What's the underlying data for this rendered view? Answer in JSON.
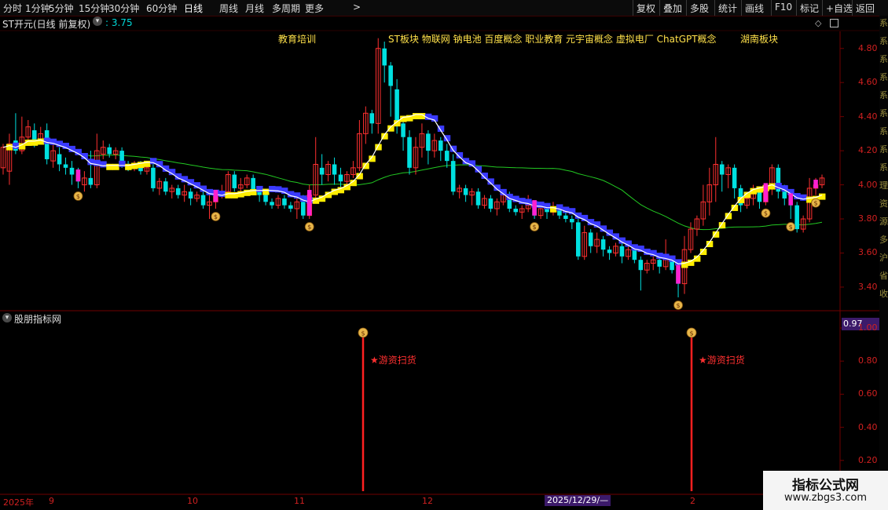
{
  "toolbar": {
    "left_items": [
      "分时",
      "1分钟",
      "5分钟",
      "15分钟",
      "30分钟",
      "60分钟",
      "日线",
      "周线",
      "月线",
      "多周期",
      "更多"
    ],
    "active": "日线",
    "more_arrow": ">",
    "right_items": [
      "复权",
      "叠加",
      "多股",
      "统计",
      "画线",
      "F10",
      "标记",
      "+自选",
      "返回"
    ]
  },
  "main_title": {
    "name": "ST开元(日线 前复权)",
    "price_label": ": 3.75",
    "price_color": "#00d8d8"
  },
  "concepts": [
    {
      "text": "教育培训"
    },
    {
      "text": "ST板块 物联网 钠电池 百度概念 职业教育 元宇宙概念 虚拟电厂 ChatGPT概念"
    },
    {
      "text": "湖南板块"
    }
  ],
  "right_strip_chars": [
    "系",
    "系",
    "系",
    "系",
    "系",
    "系",
    "系",
    "系",
    "系",
    "理",
    "资",
    "源",
    "多",
    "沪",
    "省",
    "收"
  ],
  "price_axis": [
    "4.80",
    "4.60",
    "4.40",
    "4.20",
    "4.00",
    "3.80",
    "3.60",
    "3.40"
  ],
  "indicator": {
    "name": "股朋指标网",
    "current_value": "0.97",
    "axis": [
      "1.00",
      "0.80",
      "0.60",
      "0.40",
      "0.20"
    ],
    "signal_text": "★游资扫货",
    "bag_glyph": "$"
  },
  "date_axis": {
    "labels": [
      "2025年",
      "9",
      "10",
      "11",
      "12",
      "2"
    ],
    "cursor_date": "2025/12/29/—"
  },
  "watermark": {
    "line1": "指标公式网",
    "line2": "www.zbgs3.com"
  },
  "colors": {
    "up": "#ff3030",
    "down": "#00e0e0",
    "yellow": "#ffee00",
    "blue": "#3a3aff",
    "magenta": "#ff20d0",
    "green_ma": "#22c822",
    "white_ma": "#ffffff",
    "grid": "#700000"
  },
  "chart_data": {
    "type": "candlestick",
    "y_range": [
      3.28,
      4.9
    ],
    "candles": [
      [
        4.1,
        4.22,
        4.06,
        4.24
      ],
      [
        4.08,
        4.24,
        4.0,
        4.3
      ],
      [
        4.26,
        4.2,
        4.18,
        4.42
      ],
      [
        4.2,
        4.28,
        4.18,
        4.4
      ],
      [
        4.28,
        4.34,
        4.24,
        4.38
      ],
      [
        4.32,
        4.26,
        4.22,
        4.36
      ],
      [
        4.26,
        4.3,
        4.24,
        4.34
      ],
      [
        4.32,
        4.15,
        4.12,
        4.36
      ],
      [
        4.14,
        4.2,
        4.1,
        4.25
      ],
      [
        4.18,
        4.12,
        4.08,
        4.22
      ],
      [
        4.12,
        4.1,
        4.06,
        4.16
      ],
      [
        4.1,
        4.06,
        4.0,
        4.14
      ],
      [
        4.06,
        4.02,
        3.98,
        4.1
      ],
      [
        4.0,
        4.04,
        3.96,
        4.08
      ],
      [
        4.04,
        4.0,
        3.98,
        4.2
      ],
      [
        4.0,
        4.2,
        3.98,
        4.3
      ],
      [
        4.18,
        4.22,
        4.15,
        4.26
      ],
      [
        4.22,
        4.18,
        4.16,
        4.24
      ],
      [
        4.18,
        4.2,
        4.15,
        4.22
      ],
      [
        4.2,
        4.12,
        4.1,
        4.22
      ],
      [
        4.12,
        4.1,
        4.08,
        4.14
      ],
      [
        4.1,
        4.12,
        4.08,
        4.14
      ],
      [
        4.12,
        4.08,
        4.06,
        4.14
      ],
      [
        4.08,
        4.1,
        4.06,
        4.12
      ],
      [
        4.1,
        3.98,
        3.96,
        4.12
      ],
      [
        3.98,
        4.02,
        3.94,
        4.04
      ],
      [
        4.02,
        3.96,
        3.94,
        4.04
      ],
      [
        3.96,
        3.98,
        3.92,
        4.0
      ],
      [
        3.98,
        3.94,
        3.92,
        4.0
      ],
      [
        3.94,
        3.96,
        3.9,
        4.0
      ],
      [
        3.96,
        3.92,
        3.88,
        3.98
      ],
      [
        3.92,
        3.94,
        3.9,
        3.96
      ],
      [
        3.94,
        3.88,
        3.86,
        3.96
      ],
      [
        3.88,
        3.9,
        3.8,
        3.94
      ],
      [
        3.9,
        3.94,
        3.86,
        3.96
      ],
      [
        3.94,
        3.96,
        3.92,
        4.0
      ],
      [
        3.96,
        4.06,
        3.94,
        4.08
      ],
      [
        4.06,
        3.98,
        3.96,
        4.08
      ],
      [
        3.98,
        4.0,
        3.94,
        4.04
      ],
      [
        4.0,
        4.04,
        3.98,
        4.06
      ],
      [
        4.04,
        3.96,
        3.94,
        4.06
      ],
      [
        3.96,
        3.94,
        3.9,
        3.98
      ],
      [
        3.94,
        3.9,
        3.88,
        3.96
      ],
      [
        3.9,
        3.88,
        3.86,
        3.92
      ],
      [
        3.88,
        3.92,
        3.86,
        3.94
      ],
      [
        3.92,
        3.88,
        3.86,
        3.94
      ],
      [
        3.88,
        3.86,
        3.84,
        3.9
      ],
      [
        3.86,
        3.9,
        3.8,
        3.92
      ],
      [
        3.9,
        3.82,
        3.8,
        3.94
      ],
      [
        3.82,
        3.94,
        3.8,
        4.0
      ],
      [
        3.94,
        4.12,
        3.92,
        4.28
      ],
      [
        4.1,
        4.06,
        4.0,
        4.18
      ],
      [
        4.06,
        4.12,
        4.02,
        4.14
      ],
      [
        4.12,
        4.06,
        4.0,
        4.16
      ],
      [
        4.06,
        4.02,
        3.98,
        4.1
      ],
      [
        4.02,
        4.06,
        4.0,
        4.08
      ],
      [
        4.06,
        4.1,
        4.04,
        4.14
      ],
      [
        4.1,
        4.3,
        4.08,
        4.38
      ],
      [
        4.3,
        4.42,
        4.24,
        4.46
      ],
      [
        4.42,
        4.36,
        4.3,
        4.44
      ],
      [
        4.36,
        4.8,
        4.3,
        4.86
      ],
      [
        4.8,
        4.7,
        4.6,
        4.84
      ],
      [
        4.7,
        4.58,
        4.4,
        4.72
      ],
      [
        4.56,
        4.36,
        4.3,
        4.62
      ],
      [
        4.36,
        4.28,
        4.2,
        4.4
      ],
      [
        4.28,
        4.1,
        4.06,
        4.32
      ],
      [
        4.1,
        4.22,
        4.06,
        4.28
      ],
      [
        4.22,
        4.3,
        4.16,
        4.36
      ],
      [
        4.3,
        4.2,
        4.12,
        4.32
      ],
      [
        4.2,
        4.26,
        4.16,
        4.3
      ],
      [
        4.26,
        4.2,
        4.14,
        4.28
      ],
      [
        4.2,
        4.14,
        4.1,
        4.24
      ],
      [
        4.14,
        3.96,
        3.94,
        4.18
      ],
      [
        3.96,
        3.98,
        3.92,
        4.0
      ],
      [
        3.98,
        3.94,
        3.9,
        4.0
      ],
      [
        3.94,
        3.96,
        3.88,
        3.98
      ],
      [
        3.96,
        3.88,
        3.86,
        3.98
      ],
      [
        3.88,
        3.92,
        3.86,
        3.94
      ],
      [
        3.92,
        3.86,
        3.84,
        3.94
      ],
      [
        3.86,
        3.9,
        3.82,
        3.92
      ],
      [
        3.9,
        3.94,
        3.88,
        3.96
      ],
      [
        3.94,
        3.86,
        3.84,
        3.96
      ],
      [
        3.86,
        3.84,
        3.82,
        3.88
      ],
      [
        3.84,
        3.86,
        3.8,
        3.88
      ],
      [
        3.86,
        3.88,
        3.84,
        3.94
      ],
      [
        3.88,
        3.82,
        3.8,
        3.9
      ],
      [
        3.82,
        3.86,
        3.8,
        3.88
      ],
      [
        3.86,
        3.84,
        3.8,
        3.88
      ],
      [
        3.84,
        3.86,
        3.82,
        3.9
      ],
      [
        3.86,
        3.82,
        3.8,
        3.88
      ],
      [
        3.82,
        3.8,
        3.78,
        3.84
      ],
      [
        3.8,
        3.78,
        3.74,
        3.82
      ],
      [
        3.78,
        3.58,
        3.56,
        3.8
      ],
      [
        3.58,
        3.72,
        3.56,
        3.76
      ],
      [
        3.72,
        3.64,
        3.6,
        3.74
      ],
      [
        3.64,
        3.68,
        3.6,
        3.72
      ],
      [
        3.68,
        3.62,
        3.58,
        3.7
      ],
      [
        3.62,
        3.6,
        3.56,
        3.64
      ],
      [
        3.6,
        3.64,
        3.58,
        3.66
      ],
      [
        3.64,
        3.58,
        3.54,
        3.66
      ],
      [
        3.58,
        3.62,
        3.56,
        3.64
      ],
      [
        3.62,
        3.56,
        3.54,
        3.64
      ],
      [
        3.56,
        3.5,
        3.38,
        3.58
      ],
      [
        3.5,
        3.54,
        3.48,
        3.56
      ],
      [
        3.54,
        3.56,
        3.5,
        3.58
      ],
      [
        3.56,
        3.52,
        3.48,
        3.6
      ],
      [
        3.52,
        3.56,
        3.5,
        3.68
      ],
      [
        3.56,
        3.5,
        3.48,
        3.58
      ],
      [
        3.5,
        3.42,
        3.34,
        3.52
      ],
      [
        3.42,
        3.62,
        3.36,
        3.7
      ],
      [
        3.62,
        3.74,
        3.6,
        3.78
      ],
      [
        3.74,
        3.8,
        3.7,
        3.82
      ],
      [
        3.8,
        3.9,
        3.76,
        4.0
      ],
      [
        3.9,
        4.0,
        3.82,
        4.1
      ],
      [
        4.0,
        4.12,
        3.9,
        4.28
      ],
      [
        4.12,
        4.06,
        3.96,
        4.14
      ],
      [
        4.06,
        4.1,
        3.98,
        4.12
      ],
      [
        4.1,
        3.98,
        3.92,
        4.12
      ],
      [
        3.98,
        3.88,
        3.84,
        4.0
      ],
      [
        3.88,
        3.92,
        3.86,
        3.94
      ],
      [
        3.92,
        3.96,
        3.88,
        4.0
      ],
      [
        3.96,
        3.9,
        3.86,
        3.98
      ],
      [
        3.9,
        3.98,
        3.88,
        4.0
      ],
      [
        3.98,
        4.1,
        3.94,
        4.12
      ],
      [
        4.1,
        3.96,
        3.92,
        4.12
      ],
      [
        3.96,
        3.92,
        3.88,
        4.0
      ],
      [
        3.92,
        3.88,
        3.8,
        3.94
      ],
      [
        3.88,
        3.74,
        3.72,
        3.9
      ],
      [
        3.74,
        3.8,
        3.72,
        3.82
      ],
      [
        3.8,
        3.98,
        3.78,
        4.04
      ],
      [
        3.98,
        4.0,
        3.94,
        4.04
      ],
      [
        4.0,
        4.04,
        3.98,
        4.06
      ]
    ],
    "signal_bars_indices": [
      44,
      110
    ]
  }
}
